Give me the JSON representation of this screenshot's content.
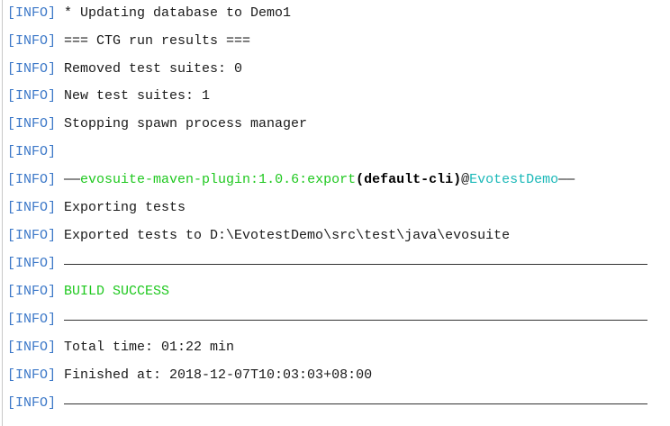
{
  "console": {
    "tag": "[INFO]",
    "lines": [
      {
        "text": "* Updating database to Demo1"
      },
      {
        "text": "=== CTG run results ==="
      },
      {
        "text": "Removed test suites: 0"
      },
      {
        "text": "New test suites: 1"
      },
      {
        "text": "Stopping spawn process manager"
      },
      {
        "text": ""
      },
      {
        "prefix": "——",
        "plugin": "evosuite-maven-plugin:1.0.6:export",
        "execution": "(default-cli)",
        "at": "@",
        "project": "EvotestDemo",
        "suffix": "——"
      },
      {
        "text": "Exporting tests"
      },
      {
        "text": "Exported tests to D:\\EvotestDemo\\src\\test\\java\\evosuite"
      },
      {
        "separator": true
      },
      {
        "text": "BUILD SUCCESS"
      },
      {
        "separator": true
      },
      {
        "text": "Total time: 01:22 min"
      },
      {
        "text": "Finished at: 2018-12-07T10:03:03+08:00"
      },
      {
        "separator": true
      }
    ]
  },
  "colors": {
    "tag": "#3c78c8",
    "success": "#1fc81f",
    "plugin": "#1fc81f",
    "project": "#1ab8b8"
  }
}
